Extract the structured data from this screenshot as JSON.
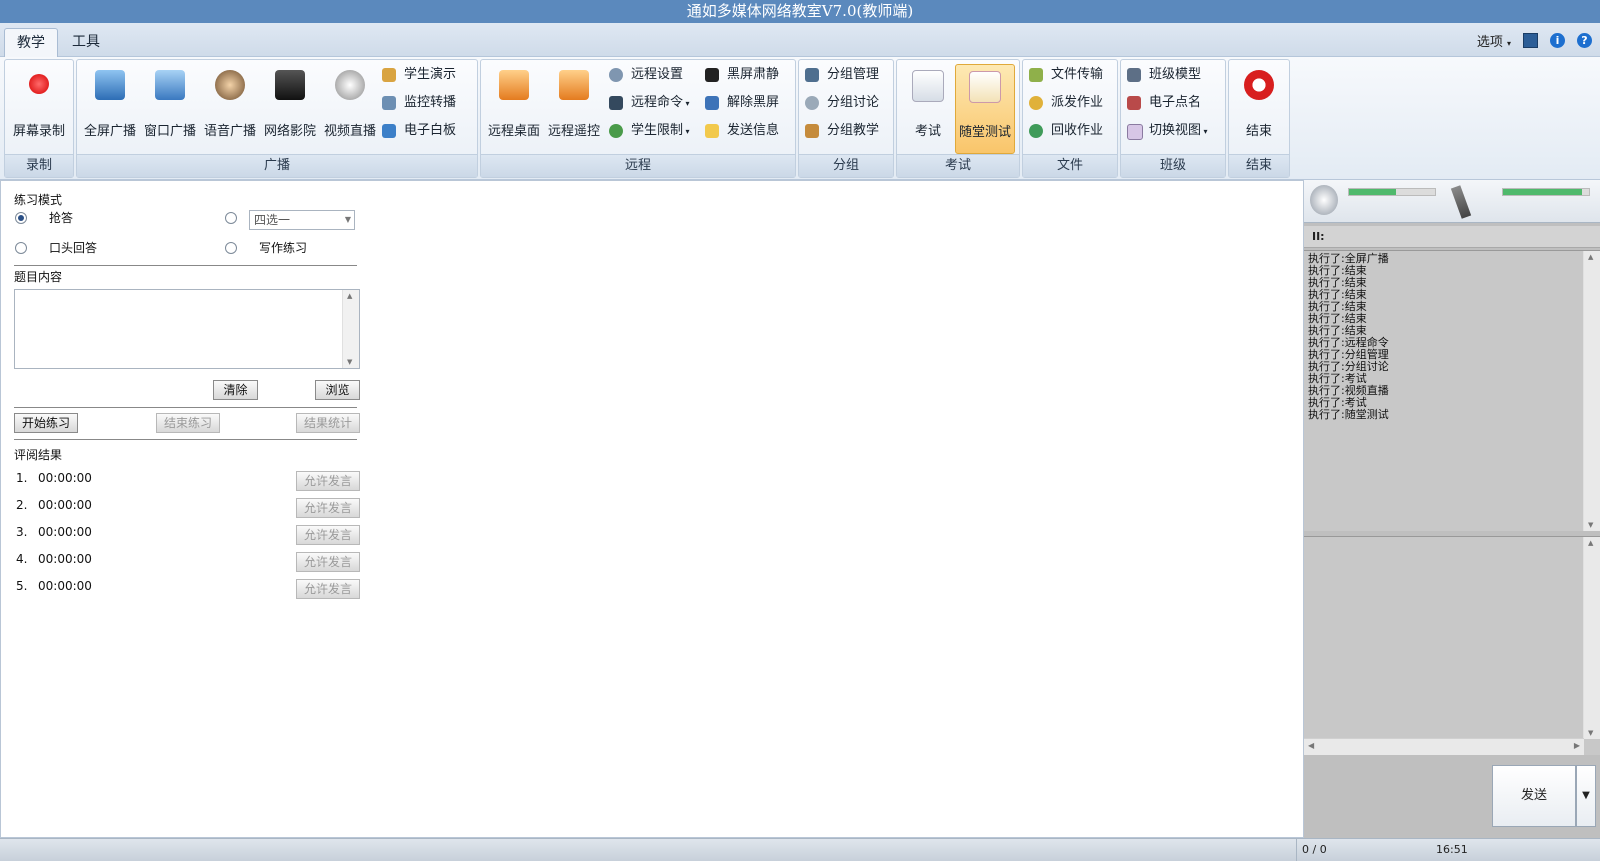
{
  "window": {
    "title": "通如多媒体网络教室V7.0(教师端)"
  },
  "menu": {
    "tabs": [
      "教学",
      "工具"
    ],
    "options_label": "选项"
  },
  "ribbon": {
    "record": {
      "group": "录制",
      "screen_record": "屏幕录制"
    },
    "broadcast": {
      "group": "广播",
      "full_screen": "全屏广播",
      "window": "窗口广播",
      "voice": "语音广播",
      "movie": "网络影院",
      "video_live": "视频直播",
      "student_demo": "学生演示",
      "monitor_relay": "监控转播",
      "whiteboard": "电子白板"
    },
    "remote": {
      "group": "远程",
      "desktop": "远程桌面",
      "control": "远程遥控",
      "settings": "远程设置",
      "command": "远程命令",
      "limit": "学生限制",
      "black_quiet": "黑屏肃静",
      "unblack": "解除黑屏",
      "send_info": "发送信息"
    },
    "grouping": {
      "group": "分组",
      "manage": "分组管理",
      "discuss": "分组讨论",
      "teach": "分组教学"
    },
    "exam": {
      "group": "考试",
      "exam": "考试",
      "quiz": "随堂测试"
    },
    "file": {
      "group": "文件",
      "transfer": "文件传输",
      "distribute": "派发作业",
      "collect": "回收作业"
    },
    "class": {
      "group": "班级",
      "model": "班级模型",
      "rollcall": "电子点名",
      "switch_view": "切换视图"
    },
    "end": {
      "group": "结束",
      "end": "结束"
    }
  },
  "practice": {
    "mode_label": "练习模式",
    "options": [
      "抢答",
      "口头回答",
      "写作练习"
    ],
    "combo_value": "四选一",
    "content_label": "题目内容",
    "clear": "清除",
    "browse": "浏览",
    "start": "开始练习",
    "stop": "结束练习",
    "stats": "结果统计",
    "results_label": "评阅结果",
    "results": [
      {
        "index": "1.",
        "time": "00:00:00",
        "action": "允许发言"
      },
      {
        "index": "2.",
        "time": "00:00:00",
        "action": "允许发言"
      },
      {
        "index": "3.",
        "time": "00:00:00",
        "action": "允许发言"
      },
      {
        "index": "4.",
        "time": "00:00:00",
        "action": "允许发言"
      },
      {
        "index": "5.",
        "time": "00:00:00",
        "action": "允许发言"
      }
    ]
  },
  "side": {
    "speaker_level": 0.55,
    "mic_level": 0.92,
    "log_header": "II:",
    "log": [
      "执行了:全屏广播",
      "执行了:结束",
      "执行了:结束",
      "执行了:结束",
      "执行了:结束",
      "执行了:结束",
      "执行了:结束",
      "执行了:远程命令",
      "执行了:分组管理",
      "执行了:分组讨论",
      "执行了:考试",
      "执行了:视频直播",
      "执行了:考试",
      "执行了:随堂测试"
    ],
    "send": "发送"
  },
  "status": {
    "count": "0 / 0",
    "time": "16:51"
  },
  "colors": {
    "titlebar": "#5b89bd",
    "accent": "#f9c56a",
    "level": "#4fb96c"
  }
}
